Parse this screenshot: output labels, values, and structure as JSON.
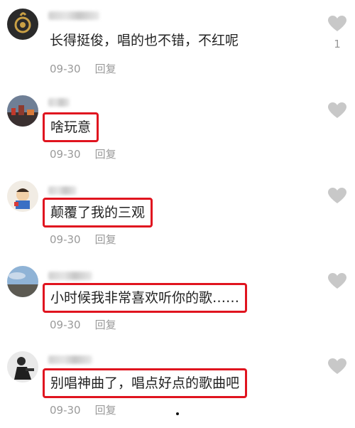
{
  "comments": [
    {
      "text": "长得挺俊，唱的也不错，不红呢",
      "date": "09-30",
      "reply": "回复",
      "likes": "1",
      "highlighted": false
    },
    {
      "text": "啥玩意",
      "date": "09-30",
      "reply": "回复",
      "likes": "",
      "highlighted": true
    },
    {
      "text": "颠覆了我的三观",
      "date": "09-30",
      "reply": "回复",
      "likes": "",
      "highlighted": true
    },
    {
      "text": "小时候我非常喜欢听你的歌……",
      "date": "09-30",
      "reply": "回复",
      "likes": "",
      "highlighted": true
    },
    {
      "text": "别唱神曲了，唱点好点的歌曲吧",
      "date": "09-30",
      "reply": "回复",
      "likes": "",
      "highlighted": true
    }
  ],
  "colors": {
    "highlight_border": "#e0141f",
    "meta_text": "#9a9a9a",
    "heart": "#c8c8c8"
  },
  "icons": {
    "like": "heart-icon"
  }
}
